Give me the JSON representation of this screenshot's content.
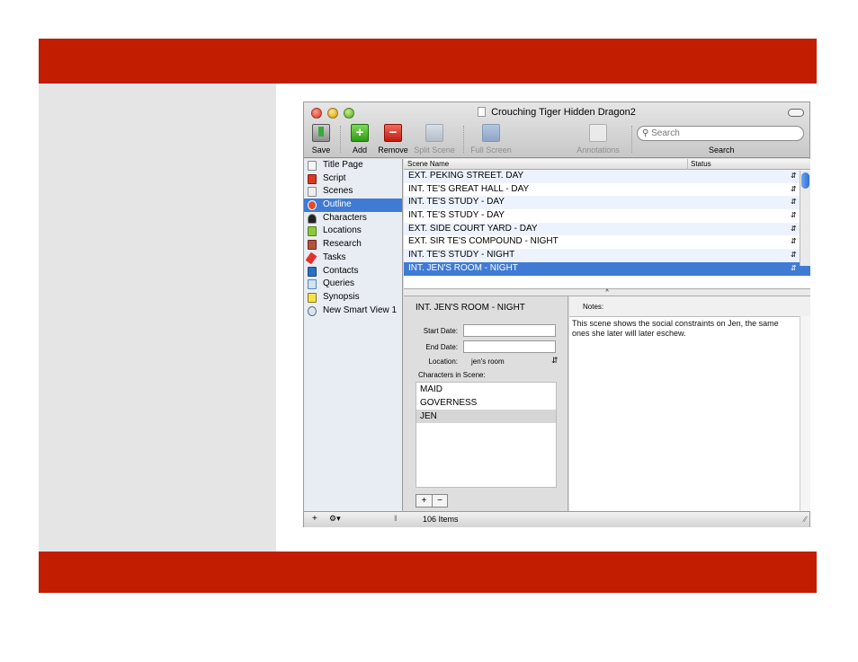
{
  "window": {
    "title": "Crouching Tiger Hidden Dragon2"
  },
  "toolbar": {
    "save_label": "Save",
    "add_label": "Add",
    "remove_label": "Remove",
    "split_label": "Split Scene",
    "fullscreen_label": "Full Screen",
    "annotations_label": "Annotations",
    "search_placeholder": "Search",
    "search_label": "Search"
  },
  "binder": {
    "items": [
      {
        "label": "Title Page",
        "icon": "title-page-icon"
      },
      {
        "label": "Script",
        "icon": "script-icon"
      },
      {
        "label": "Scenes",
        "icon": "scenes-icon"
      },
      {
        "label": "Outline",
        "icon": "outline-icon",
        "selected": true
      },
      {
        "label": "Characters",
        "icon": "characters-icon"
      },
      {
        "label": "Locations",
        "icon": "locations-icon"
      },
      {
        "label": "Research",
        "icon": "research-icon"
      },
      {
        "label": "Tasks",
        "icon": "tasks-icon"
      },
      {
        "label": "Contacts",
        "icon": "contacts-icon"
      },
      {
        "label": "Queries",
        "icon": "queries-icon"
      },
      {
        "label": "Synopsis",
        "icon": "synopsis-icon"
      },
      {
        "label": "New Smart View 1",
        "icon": "smart-view-icon"
      }
    ]
  },
  "outline": {
    "columns": {
      "scene_name": "Scene Name",
      "status": "Status"
    },
    "rows": [
      "EXT. PEKING STREET. DAY",
      "INT. TE'S GREAT HALL - DAY",
      "INT. TE'S STUDY - DAY",
      "INT. TE'S STUDY - DAY",
      "EXT. SIDE COURT YARD - DAY",
      "EXT. SIR TE'S COMPOUND - NIGHT",
      "INT. TE'S STUDY - NIGHT",
      "INT. JEN'S ROOM - NIGHT"
    ],
    "selected_index": 7
  },
  "inspector": {
    "scene_title": "INT. JEN'S ROOM - NIGHT",
    "start_date_label": "Start Date:",
    "end_date_label": "End Date:",
    "location_label": "Location:",
    "location_value": "jen's room",
    "characters_label": "Characters in Scene:",
    "characters": [
      "MAID",
      "GOVERNESS",
      "JEN"
    ],
    "selected_character_index": 2
  },
  "notes": {
    "label": "Notes:",
    "text": "This scene shows the social constraints on Jen, the same ones she later will later eschew."
  },
  "statusbar": {
    "item_count": "106 Items"
  },
  "colors": {
    "band": "#c21d00",
    "selection": "#3f7bd4",
    "alt_row": "#edf3fe"
  }
}
